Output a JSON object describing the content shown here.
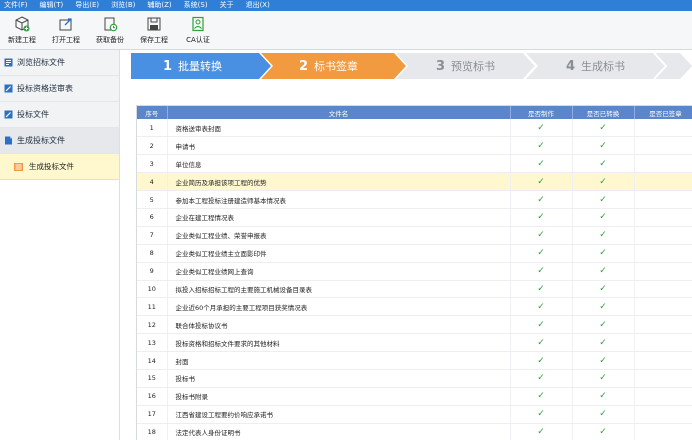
{
  "menu": [
    "文件(F)",
    "编辑(T)",
    "导出(E)",
    "浏览(B)",
    "辅助(Z)",
    "系统(S)",
    "关于",
    "退出(X)"
  ],
  "toolbar": [
    {
      "label": "新建工程",
      "icon": "new-project-icon"
    },
    {
      "label": "打开工程",
      "icon": "open-project-icon"
    },
    {
      "label": "获取备份",
      "icon": "get-backup-icon"
    },
    {
      "label": "保存工程",
      "icon": "save-icon"
    },
    {
      "label": "CA认证",
      "icon": "ca-certificate-icon"
    }
  ],
  "sidebar": {
    "items": [
      {
        "label": "浏览招标文件",
        "icon": "book-icon"
      },
      {
        "label": "投标资格送审表",
        "icon": "pencil-icon"
      },
      {
        "label": "投标文件",
        "icon": "pencil-icon"
      },
      {
        "label": "生成投标文件",
        "icon": "document-icon"
      }
    ],
    "sub": {
      "label": "生成投标文件",
      "icon": "list-icon"
    }
  },
  "steps": [
    {
      "num": "1",
      "label": "批量转换",
      "state": "done",
      "color": "#4a90e2"
    },
    {
      "num": "2",
      "label": "标书签章",
      "state": "current",
      "color": "#f29a3f"
    },
    {
      "num": "3",
      "label": "预览标书",
      "state": "pending",
      "color": "#e6e8eb"
    },
    {
      "num": "4",
      "label": "生成标书",
      "state": "pending",
      "color": "#e6e8eb"
    }
  ],
  "table": {
    "headers": [
      "序号",
      "文件名",
      "是否制作",
      "是否已转换",
      "是否已签章"
    ],
    "rows": [
      {
        "no": "1",
        "name": "资格送审表封面",
        "made": "✓",
        "converted": "✓",
        "signed": ""
      },
      {
        "no": "2",
        "name": "申请书",
        "made": "✓",
        "converted": "✓",
        "signed": ""
      },
      {
        "no": "3",
        "name": "单位信息",
        "made": "✓",
        "converted": "✓",
        "signed": ""
      },
      {
        "no": "4",
        "name": "企业简历及承担该项工程的优势",
        "made": "✓",
        "converted": "✓",
        "signed": ""
      },
      {
        "no": "5",
        "name": "参加本工程投标注册建造师基本情况表",
        "made": "✓",
        "converted": "✓",
        "signed": ""
      },
      {
        "no": "6",
        "name": "企业在建工程情况表",
        "made": "✓",
        "converted": "✓",
        "signed": ""
      },
      {
        "no": "7",
        "name": "企业类似工程业绩、荣誉申报表",
        "made": "✓",
        "converted": "✓",
        "signed": ""
      },
      {
        "no": "8",
        "name": "企业类似工程业绩主立面影印件",
        "made": "✓",
        "converted": "✓",
        "signed": ""
      },
      {
        "no": "9",
        "name": "企业类似工程业绩网上查询",
        "made": "✓",
        "converted": "✓",
        "signed": ""
      },
      {
        "no": "10",
        "name": "拟投入招标招标工程的主要施工机械设备目录表",
        "made": "✓",
        "converted": "✓",
        "signed": ""
      },
      {
        "no": "11",
        "name": "企业近60个月承担的主要工程项目获奖情况表",
        "made": "✓",
        "converted": "✓",
        "signed": ""
      },
      {
        "no": "12",
        "name": "联合体投标协议书",
        "made": "✓",
        "converted": "✓",
        "signed": ""
      },
      {
        "no": "13",
        "name": "投标资格和招标文件要求的其他材料",
        "made": "✓",
        "converted": "✓",
        "signed": ""
      },
      {
        "no": "14",
        "name": "封面",
        "made": "✓",
        "converted": "✓",
        "signed": ""
      },
      {
        "no": "15",
        "name": "投标书",
        "made": "✓",
        "converted": "✓",
        "signed": ""
      },
      {
        "no": "16",
        "name": "投标书附录",
        "made": "✓",
        "converted": "✓",
        "signed": ""
      },
      {
        "no": "17",
        "name": "江西省建设工程要约价响应承诺书",
        "made": "✓",
        "converted": "✓",
        "signed": ""
      },
      {
        "no": "18",
        "name": "法定代表人身份证明书",
        "made": "✓",
        "converted": "✓",
        "signed": ""
      }
    ],
    "highlight_row": 3
  }
}
